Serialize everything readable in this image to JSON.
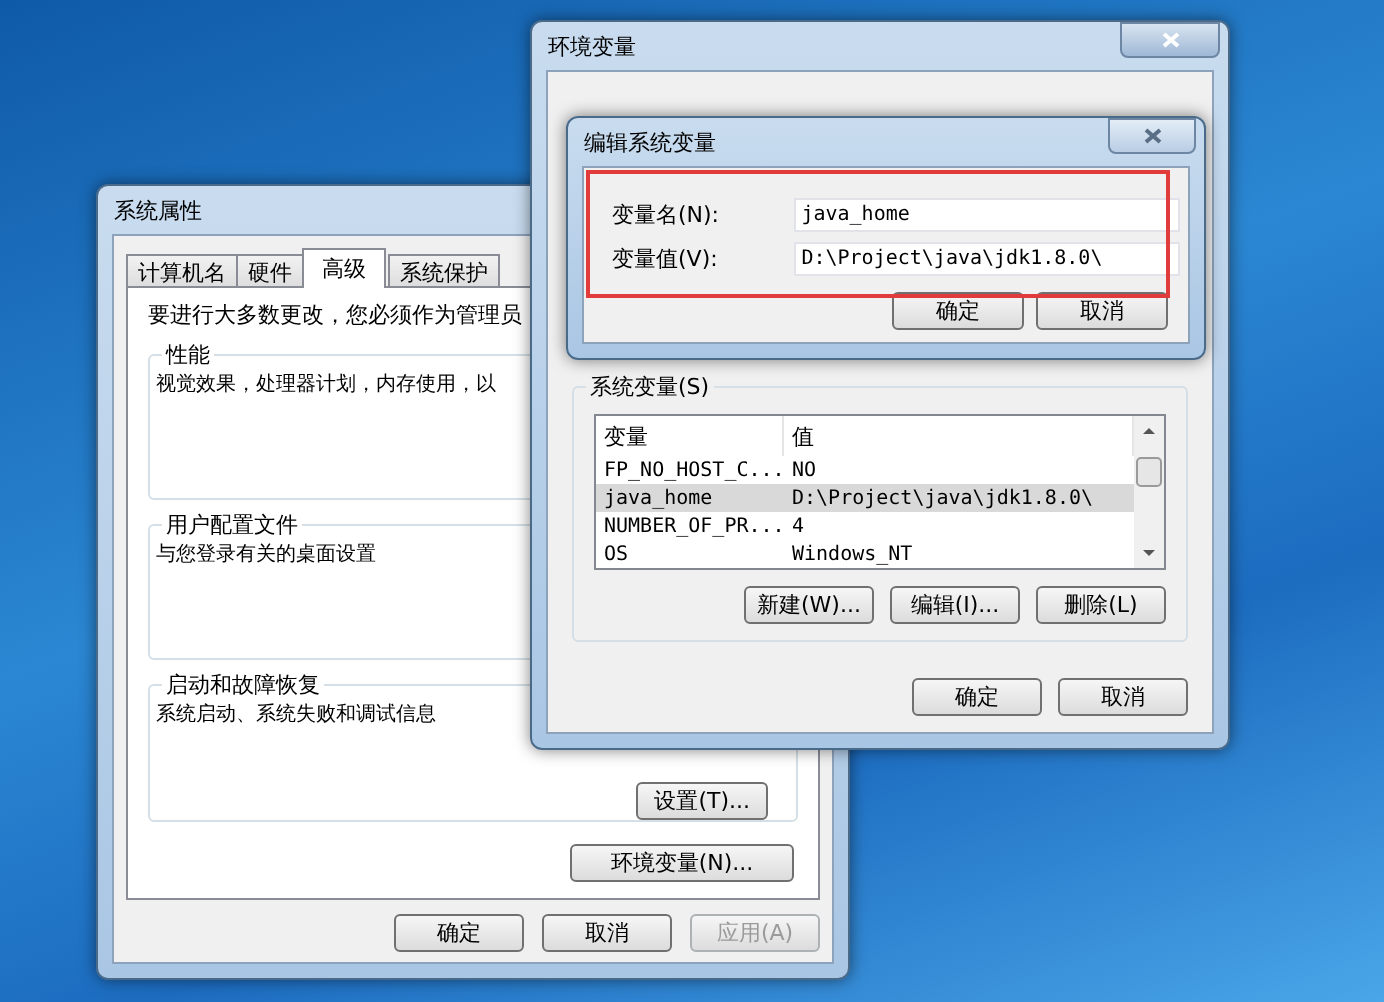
{
  "system_properties": {
    "title": "系统属性",
    "tabs": [
      {
        "label": "计算机名",
        "selected": false
      },
      {
        "label": "硬件",
        "selected": false
      },
      {
        "label": "高级",
        "selected": true
      },
      {
        "label": "系统保护",
        "selected": false
      }
    ],
    "notice": "要进行大多数更改，您必须作为管理员",
    "groups": [
      {
        "title": "性能",
        "description": "视觉效果，处理器计划，内存使用，以"
      },
      {
        "title": "用户配置文件",
        "description": "与您登录有关的桌面设置"
      },
      {
        "title": "启动和故障恢复",
        "description": "系统启动、系统失败和调试信息",
        "button": "设置(T)..."
      }
    ],
    "env_button": "环境变量(N)...",
    "buttons": [
      {
        "label": "确定",
        "disabled": false
      },
      {
        "label": "取消",
        "disabled": false
      },
      {
        "label": "应用(A)",
        "disabled": true
      }
    ]
  },
  "environment_variables": {
    "title": "环境变量",
    "system_variables": {
      "label": "系统变量(S)",
      "columns": [
        "变量",
        "值"
      ],
      "rows": [
        {
          "name": "FP_NO_HOST_C...",
          "value": "NO",
          "selected": false
        },
        {
          "name": "java_home",
          "value": "D:\\Project\\java\\jdk1.8.0\\",
          "selected": true
        },
        {
          "name": "NUMBER_OF_PR...",
          "value": "4",
          "selected": false
        },
        {
          "name": "OS",
          "value": "Windows_NT",
          "selected": false
        }
      ],
      "buttons": [
        "新建(W)...",
        "编辑(I)...",
        "删除(L)"
      ]
    },
    "buttons": [
      "确定",
      "取消"
    ]
  },
  "edit_dialog": {
    "title": "编辑系统变量",
    "fields": [
      {
        "label": "变量名(N):",
        "value": "java_home"
      },
      {
        "label": "变量值(V):",
        "value": "D:\\Project\\java\\jdk1.8.0\\"
      }
    ],
    "buttons": [
      "确定",
      "取消"
    ]
  }
}
